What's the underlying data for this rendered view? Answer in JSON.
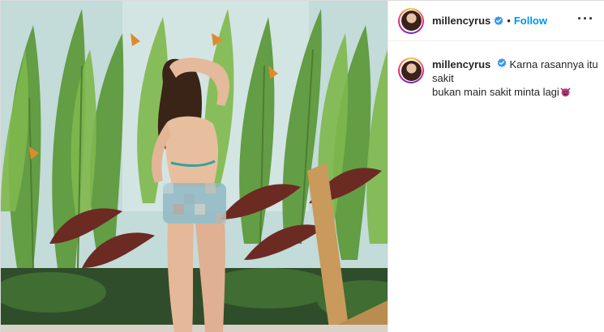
{
  "post": {
    "username": "millencyrus",
    "follow_label": "Follow",
    "separator": "•",
    "more_label": "···",
    "caption_line1": "Karna rasannya itu sakit",
    "caption_line2": "bukan main sakit minta lagi",
    "caption_emoji": "smiling-devil-icon"
  },
  "colors": {
    "follow": "#0095f6",
    "verified": "#3897f0",
    "text": "#262626",
    "border": "#dbdbdb"
  }
}
